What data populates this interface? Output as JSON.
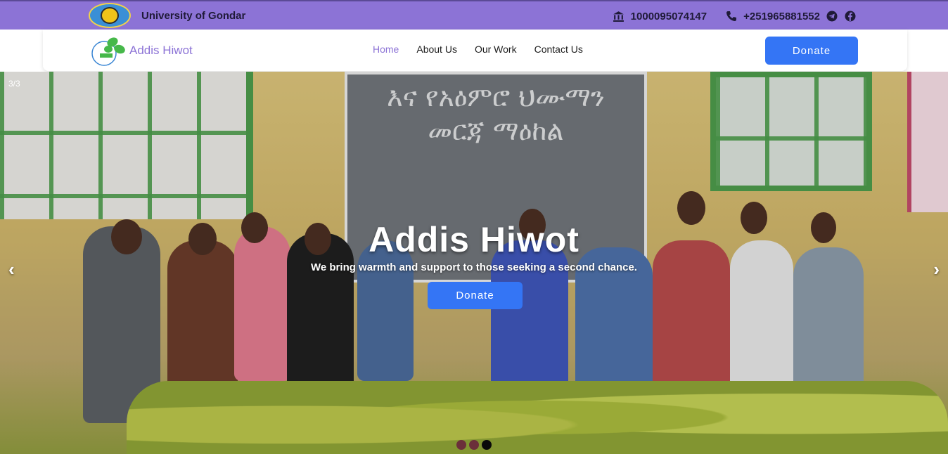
{
  "topbar": {
    "university_name": "University of Gondar",
    "account_number": "1000095074147",
    "phone": "+251965881552",
    "icons": [
      "bank-icon",
      "phone-icon",
      "telegram-icon",
      "facebook-icon"
    ]
  },
  "navbar": {
    "brand_name": "Addis Hiwot",
    "links": [
      {
        "label": "Home",
        "active": true
      },
      {
        "label": "About Us",
        "active": false
      },
      {
        "label": "Our Work",
        "active": false
      },
      {
        "label": "Contact Us",
        "active": false
      }
    ],
    "donate_label": "Donate"
  },
  "hero": {
    "slide_counter": "3/3",
    "title": "Addis Hiwot",
    "subtitle": "We bring warmth and support to those seeking a second chance.",
    "donate_label": "Donate",
    "prev_arrow": "‹",
    "next_arrow": "›",
    "dots": 3,
    "active_dot": 3
  },
  "colors": {
    "brand_purple": "#8c73d6",
    "button_blue": "#3475f5"
  }
}
